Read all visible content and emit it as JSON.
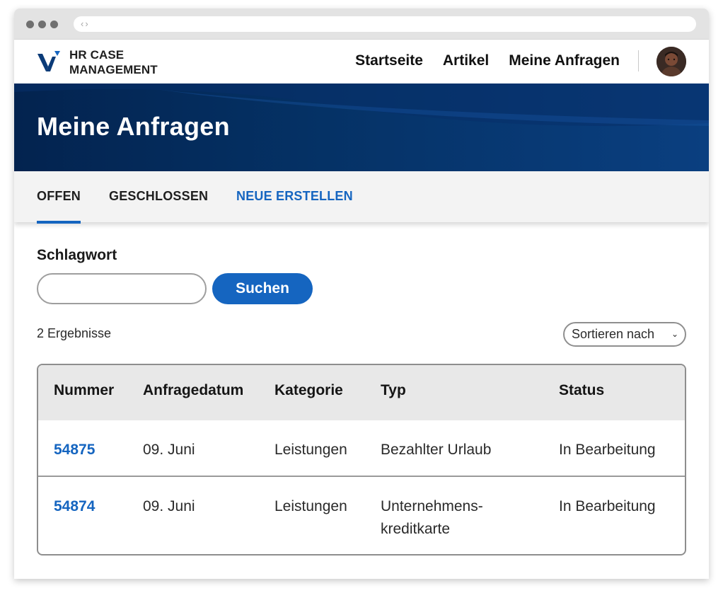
{
  "brand": {
    "line1": "HR CASE",
    "line2": "MANAGEMENT",
    "color": "#0b3b78"
  },
  "nav": {
    "items": [
      {
        "label": "Startseite"
      },
      {
        "label": "Artikel"
      },
      {
        "label": "Meine Anfragen"
      }
    ]
  },
  "hero": {
    "title": "Meine Anfragen"
  },
  "tabs": [
    {
      "label": "OFFEN",
      "active": true
    },
    {
      "label": "GESCHLOSSEN",
      "active": false
    },
    {
      "label": "NEUE ERSTELLEN",
      "active": false
    }
  ],
  "search": {
    "label": "Schlagwort",
    "value": "",
    "placeholder": "",
    "button_label": "Suchen"
  },
  "results": {
    "count_text": "2 Ergebnisse",
    "sort_label": "Sortieren nach"
  },
  "table": {
    "headers": [
      "Nummer",
      "Anfragedatum",
      "Kategorie",
      "Typ",
      "Status"
    ],
    "rows": [
      {
        "number": "54875",
        "date": "09. Juni",
        "category": "Leistungen",
        "type": "Bezahlter Urlaub",
        "type2": "",
        "status": "In Bearbeitung"
      },
      {
        "number": "54874",
        "date": "09. Juni",
        "category": "Leistungen",
        "type": "Unternehmens-",
        "type2": "kreditkarte",
        "status": "In Bearbeitung"
      }
    ]
  },
  "colors": {
    "accent": "#1565c0",
    "hero_dark": "#03234f",
    "hero_light": "#0a3f80"
  }
}
